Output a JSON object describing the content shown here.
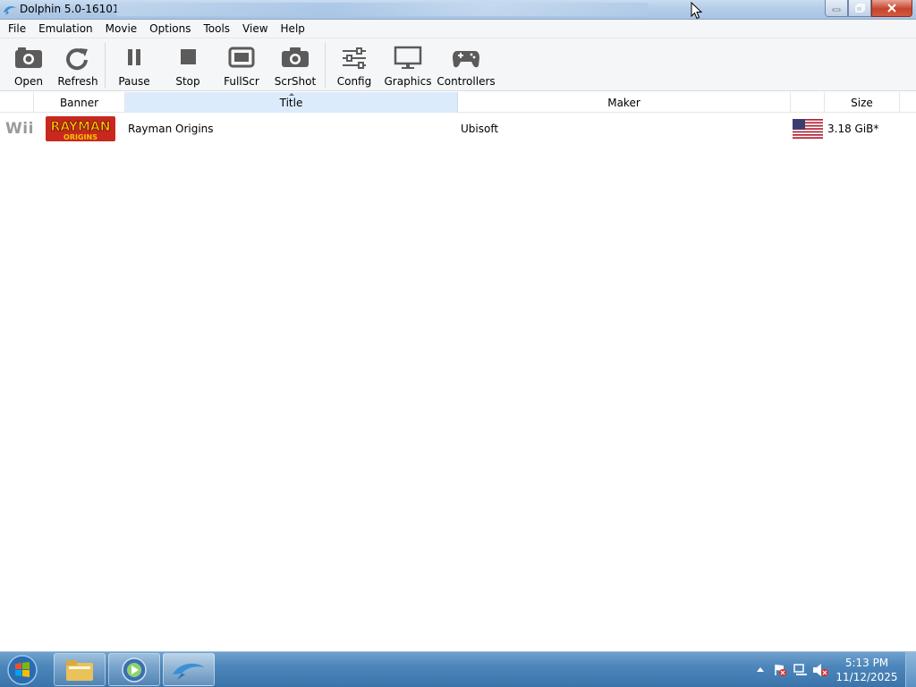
{
  "window": {
    "title": "Dolphin 5.0-16101",
    "app_icon": "dolphin-icon"
  },
  "menu": [
    "File",
    "Emulation",
    "Movie",
    "Options",
    "Tools",
    "View",
    "Help"
  ],
  "toolbar": {
    "open": "Open",
    "refresh": "Refresh",
    "pause": "Pause",
    "stop": "Stop",
    "fullscr": "FullScr",
    "scrshot": "ScrShot",
    "config": "Config",
    "graphics": "Graphics",
    "controllers": "Controllers"
  },
  "columns": {
    "banner": "Banner",
    "title": "Title",
    "maker": "Maker",
    "size": "Size",
    "sorted_by": "title"
  },
  "games": [
    {
      "platform": "Wii",
      "banner_text": "RAYMAN",
      "banner_subtext": "ORIGINS",
      "title": "Rayman Origins",
      "maker": "Ubisoft",
      "region_flag": "us-flag-icon",
      "size": "3.18 GiB*"
    }
  ],
  "taskbar": {
    "clock_time": "5:13 PM",
    "clock_date": "11/12/2025",
    "tasks": [
      "explorer-icon",
      "media-player-icon",
      "dolphin-icon"
    ]
  },
  "colors": {
    "sorted_column": "#dcebfc",
    "banner_red": "#c8281e",
    "banner_yellow": "#f5c400"
  }
}
